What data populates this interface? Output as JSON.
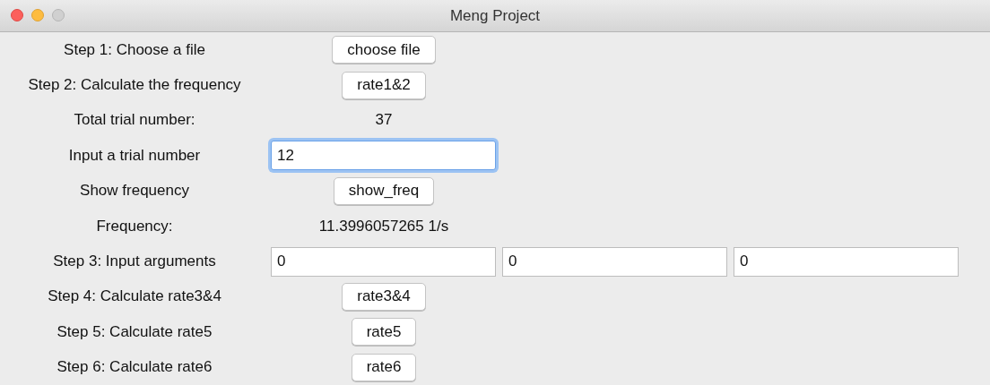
{
  "window": {
    "title": "Meng Project"
  },
  "rows": [
    {
      "kind": "button",
      "label": "Step 1: Choose a file",
      "button": "choose file"
    },
    {
      "kind": "button",
      "label": "Step 2: Calculate the frequency",
      "button": "rate1&2"
    },
    {
      "kind": "text",
      "label": "Total trial number:",
      "value": "37"
    },
    {
      "kind": "input",
      "label": "Input a trial number",
      "fields": [
        {
          "value": "12",
          "focused": true
        }
      ]
    },
    {
      "kind": "button",
      "label": "Show frequency",
      "button": "show_freq"
    },
    {
      "kind": "text",
      "label": "Frequency:",
      "value": "11.3996057265 1/s"
    },
    {
      "kind": "input",
      "label": "Step 3: Input arguments",
      "fields": [
        {
          "value": "0",
          "focused": false
        },
        {
          "value": "0",
          "focused": false
        },
        {
          "value": "0",
          "focused": false
        }
      ]
    },
    {
      "kind": "button",
      "label": "Step 4: Calculate rate3&4",
      "button": "rate3&4"
    },
    {
      "kind": "button",
      "label": "Step 5: Calculate rate5",
      "button": "rate5"
    },
    {
      "kind": "button",
      "label": "Step 6: Calculate rate6",
      "button": "rate6"
    }
  ]
}
